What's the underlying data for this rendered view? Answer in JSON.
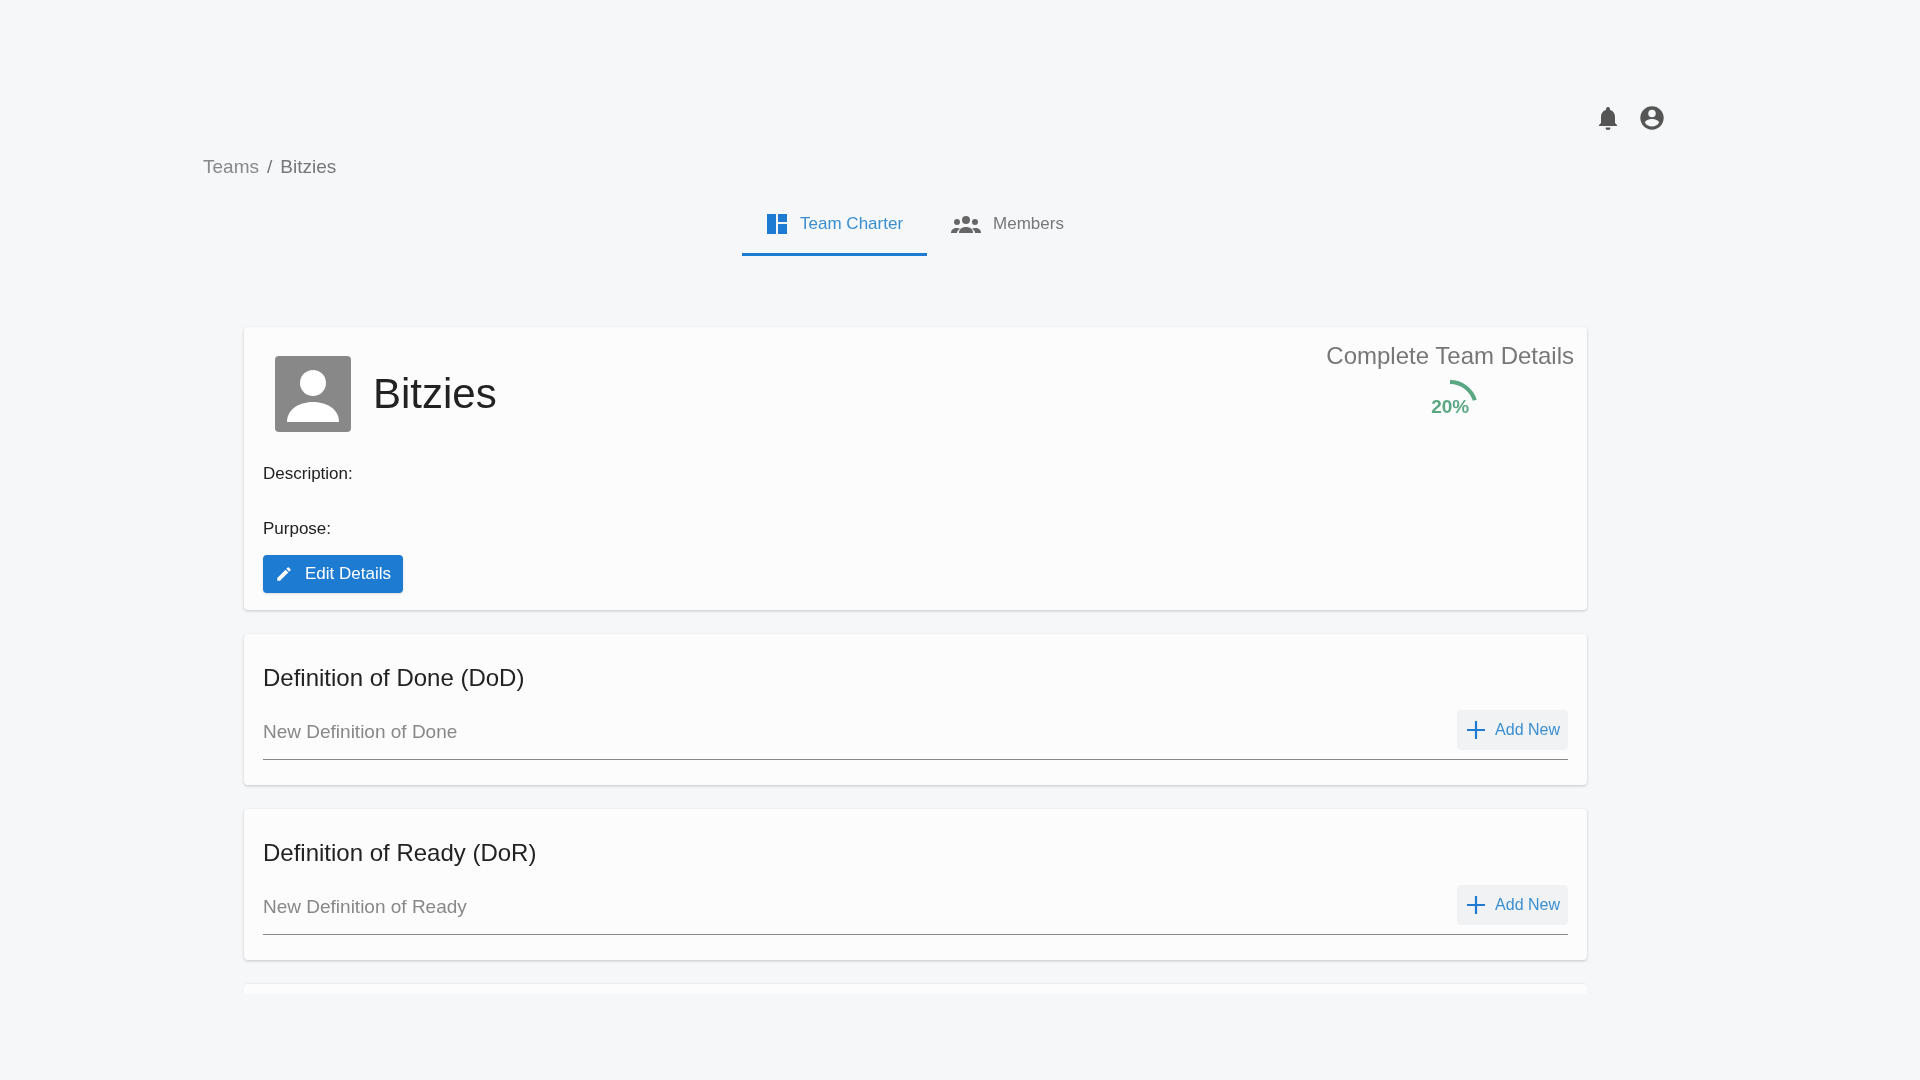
{
  "breadcrumb": {
    "items": [
      "Teams",
      "Bitzies"
    ],
    "separator": "/"
  },
  "tabs": [
    {
      "label": "Team Charter",
      "kind": "charter",
      "selected": true
    },
    {
      "label": "Members",
      "kind": "members",
      "selected": false
    }
  ],
  "team": {
    "name": "Bitzies",
    "progress": {
      "title": "Complete Team Details",
      "level": 0.2,
      "reading": "20%"
    },
    "fields": [
      "Description:",
      "Purpose:"
    ],
    "edit_button": "Edit Details"
  },
  "sections": [
    {
      "title": "Definition of Done (DoD)",
      "placeholder": "New Definition of Done",
      "button": "Add New"
    },
    {
      "title": "Definition of Ready (DoR)",
      "placeholder": "New Definition of Ready",
      "button": "Add New"
    }
  ]
}
